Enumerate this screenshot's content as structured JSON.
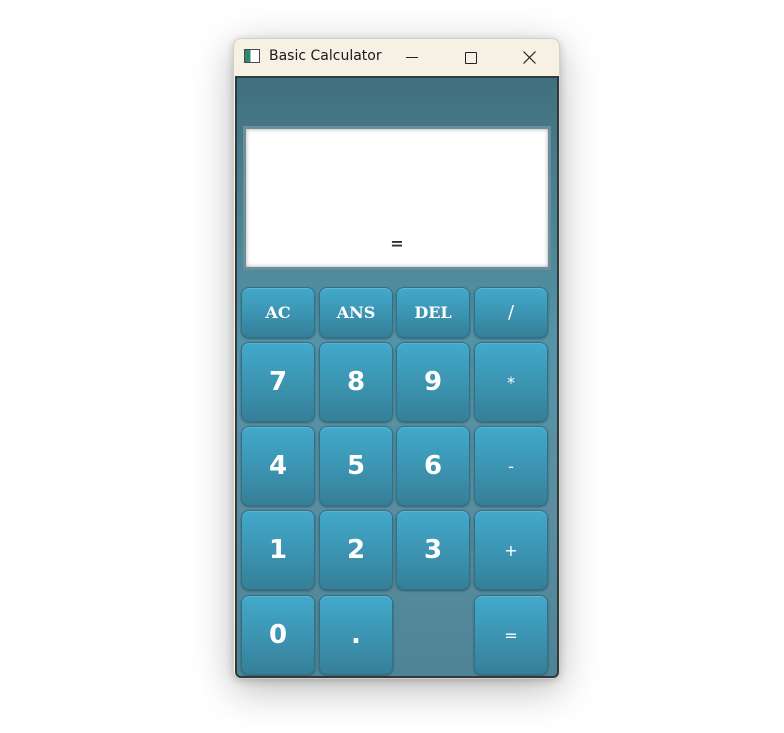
{
  "window": {
    "title": "Basic Calculator",
    "icon": "app-window-icon",
    "controls": [
      "minimize-icon",
      "maximize-icon",
      "close-icon"
    ]
  },
  "display": {
    "value": "="
  },
  "keys": {
    "row1": [
      "AC",
      "ANS",
      "DEL",
      "/"
    ],
    "row2": [
      "7",
      "8",
      "9",
      "*"
    ],
    "row3": [
      "4",
      "5",
      "6",
      "-"
    ],
    "row4": [
      "1",
      "2",
      "3",
      "+"
    ],
    "row5": [
      "0",
      ".",
      "="
    ]
  },
  "colors": {
    "titlebar": "#f6f1e4",
    "body_top": "#41707e",
    "key": "#3b93b0",
    "display_bg": "#ffffff"
  }
}
